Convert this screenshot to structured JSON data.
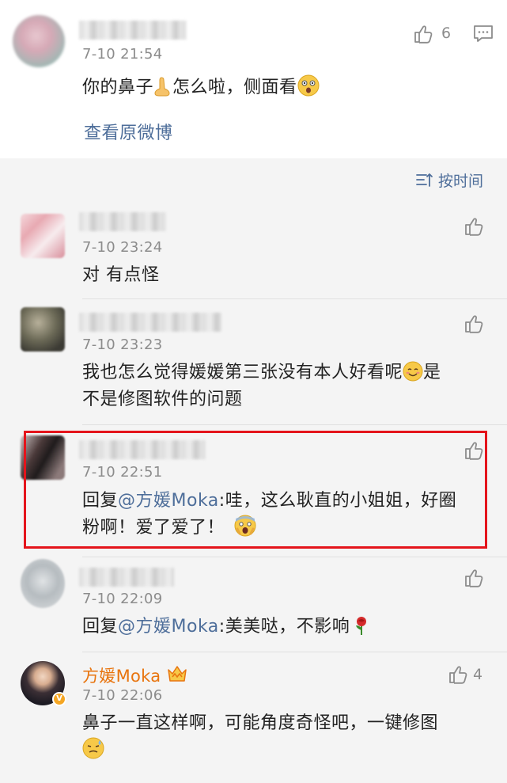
{
  "main_post": {
    "time": "7-10 21:54",
    "text_before": "你的鼻子",
    "text_middle": "怎么啦，侧面看",
    "like_count": "6",
    "view_original": "查看原微博"
  },
  "sort": {
    "label": "按时间"
  },
  "comments": [
    {
      "time": "7-10 23:24",
      "text": "对 有点怪"
    },
    {
      "time": "7-10 23:23",
      "text_line1": "我也怎么觉得媛媛第三张没有本人好看呢",
      "text_line1_end": "是",
      "text_line2": "不是修图软件的问题"
    },
    {
      "time": "7-10 22:51",
      "reply_prefix": "回复",
      "mention": "@方媛Moka",
      "text_line1": ":哇，这么耿直的小姐姐，好圈",
      "text_line2": "粉啊！爱了爱了！"
    },
    {
      "time": "7-10 22:09",
      "reply_prefix": "回复",
      "mention": "@方媛Moka",
      "text": ":美美哒，不影响"
    },
    {
      "name": "方媛Moka",
      "time": "7-10 22:06",
      "like_count": "4",
      "text": "鼻子一直这样啊，可能角度奇怪吧，一键修图"
    }
  ],
  "colors": {
    "link": "#4e6e9a",
    "highlight": "#e4141b",
    "verified_name": "#e8740e"
  }
}
